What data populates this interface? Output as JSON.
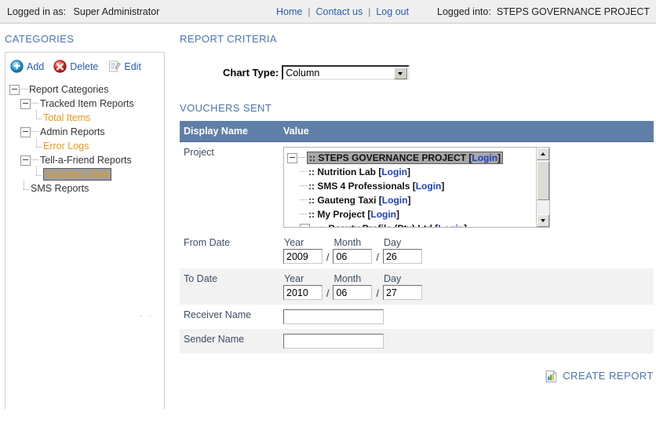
{
  "topbar": {
    "logged_in_label": "Logged in as:",
    "logged_in_user": "Super Administrator",
    "nav": [
      {
        "label": "Home"
      },
      {
        "label": "Contact us"
      },
      {
        "label": "Log out"
      }
    ],
    "separator": "|",
    "logged_into_label": "Logged into:",
    "logged_into_value": "STEPS GOVERNANCE PROJECT"
  },
  "sidebar": {
    "title": "CATEGORIES",
    "toolbar": [
      {
        "label": "Add",
        "icon": "add-circle-icon"
      },
      {
        "label": "Delete",
        "icon": "delete-circle-icon"
      },
      {
        "label": "Edit",
        "icon": "edit-pencil-icon"
      }
    ],
    "tree": [
      {
        "label": "Report Categories",
        "level": 1,
        "type": "branch",
        "selected": false
      },
      {
        "label": "Tracked Item Reports",
        "level": 2,
        "type": "branch",
        "selected": false
      },
      {
        "label": "Total Items",
        "level": 3,
        "type": "leaf",
        "selected": false
      },
      {
        "label": "Admin Reports",
        "level": 2,
        "type": "branch",
        "selected": false
      },
      {
        "label": "Error Logs",
        "level": 3,
        "type": "leaf",
        "selected": false
      },
      {
        "label": "Tell-a-Friend Reports",
        "level": 2,
        "type": "branch",
        "selected": false
      },
      {
        "label": "Vouchers Sent",
        "level": 3,
        "type": "leaf",
        "selected": true
      },
      {
        "label": "SMS Reports",
        "level": 2,
        "type": "leaf-branch",
        "selected": false
      }
    ]
  },
  "main": {
    "report_criteria_title": "REPORT CRITERIA",
    "chart_type_label": "Chart Type:",
    "chart_type_value": "Column",
    "vouchers_title": "VOUCHERS SENT",
    "table_headers": {
      "display_name": "Display Name",
      "value": "Value"
    },
    "rows": {
      "project_label": "Project",
      "from_date_label": "From Date",
      "to_date_label": "To Date",
      "receiver_name_label": "Receiver Name",
      "sender_name_label": "Sender Name"
    },
    "project_list": [
      {
        "name": ":: STEPS GOVERNANCE PROJECT",
        "link": "Login",
        "selected": true,
        "expandable": true
      },
      {
        "name": ":: Nutrition Lab",
        "link": "Login",
        "selected": false,
        "expandable": false
      },
      {
        "name": ":: SMS 4 Professionals",
        "link": "Login",
        "selected": false,
        "expandable": false
      },
      {
        "name": ":: Gauteng Taxi",
        "link": "Login",
        "selected": false,
        "expandable": false
      },
      {
        "name": ":: My Project",
        "link": "Login",
        "selected": false,
        "expandable": false
      },
      {
        "name": ":: Beauty Profile (Pty) Ltd",
        "link": "Login",
        "selected": false,
        "expandable": true
      }
    ],
    "date_labels": {
      "year": "Year",
      "month": "Month",
      "day": "Day",
      "separator": "/"
    },
    "from_date": {
      "year": "2009",
      "month": "06",
      "day": "26"
    },
    "to_date": {
      "year": "2010",
      "month": "06",
      "day": "27"
    },
    "receiver_name_value": "",
    "sender_name_value": "",
    "receiver_name_placeholder": "",
    "sender_name_placeholder": "",
    "create_report_label": "CREATE REPORT",
    "create_report_icon": "chart-report-icon"
  },
  "colors": {
    "heading_blue": "#4a75b5",
    "table_header_blue": "#5f7fa8",
    "link_blue": "#2a5db0",
    "leaf_orange": "#e8991c",
    "login_link_blue": "#1b3fc4"
  }
}
